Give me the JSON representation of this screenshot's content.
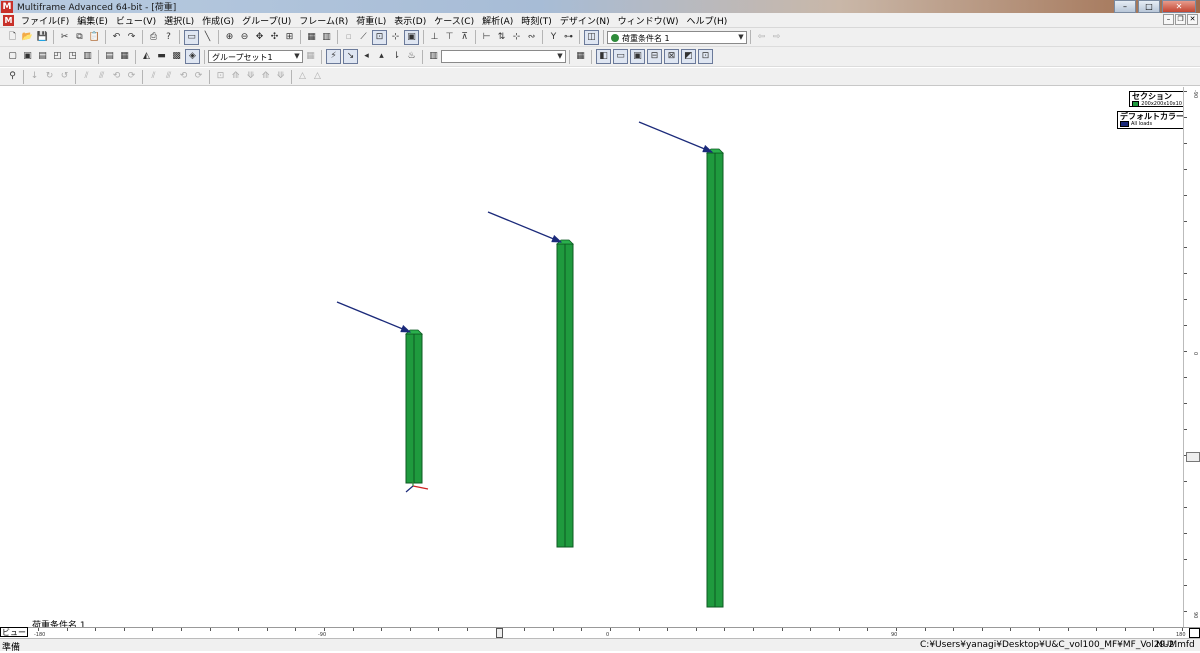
{
  "window": {
    "title": "Multiframe Advanced 64-bit - [荷重]",
    "app_icon": "M"
  },
  "menu": {
    "items": [
      "ファイル(F)",
      "編集(E)",
      "ビュー(V)",
      "選択(L)",
      "作成(G)",
      "グループ(U)",
      "フレーム(R)",
      "荷重(L)",
      "表示(D)",
      "ケース(C)",
      "解析(A)",
      "時刻(T)",
      "デザイン(N)",
      "ウィンドウ(W)",
      "ヘルプ(H)"
    ]
  },
  "toolbar1": {
    "load_case_combo": "荷重条件名 1"
  },
  "toolbar2": {
    "group_set_combo": "グループセット1",
    "empty_combo": ""
  },
  "canvas": {
    "legend_section_title": "セクション",
    "legend_section_item": "200x200x10x10",
    "legend_color_title": "デフォルトカラー",
    "legend_color_item": "All loads",
    "loadcase_caption": "荷重条件名 1",
    "member_color": "#1f9a3e",
    "load_arrow_color": "#1b2a7a"
  },
  "ruler": {
    "view_tab": "ビュー",
    "labels": [
      "-180",
      "-90",
      "0",
      "90",
      "180"
    ],
    "vertical_labels": [
      "-90",
      "0",
      "90"
    ]
  },
  "status": {
    "left": "準備",
    "path": "C:¥Users¥yanagi¥Desktop¥U&C_vol100_MF¥MF_Vol29-2.mfd",
    "num": "NUM"
  }
}
